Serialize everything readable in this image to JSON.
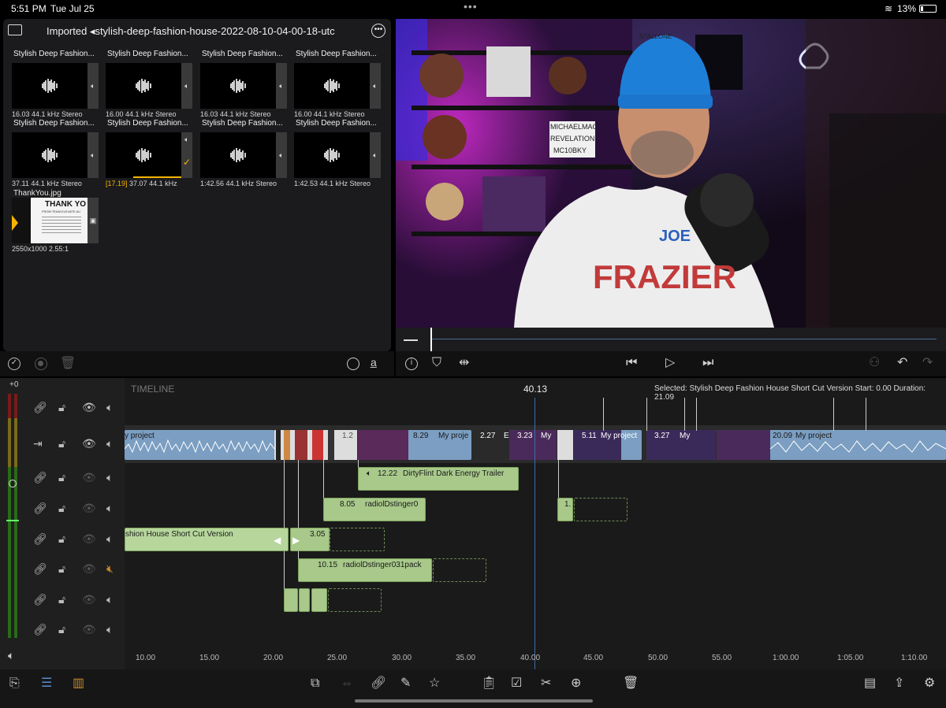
{
  "status_bar": {
    "time": "5:51 PM",
    "date": "Tue Jul 25",
    "battery": "13%",
    "dots": "•••"
  },
  "browser": {
    "folder_title": "Imported ◂stylish-deep-fashion-house-2022-08-10-04-00-18-utc",
    "items": [
      {
        "title": "Stylish Deep Fashion...",
        "meta": "16.03  44.1 kHz  Stereo"
      },
      {
        "title": "Stylish Deep Fashion...",
        "meta": "16.00  44.1 kHz  Stereo"
      },
      {
        "title": "Stylish Deep Fashion...",
        "meta": "16.03  44.1 kHz  Stereo"
      },
      {
        "title": "Stylish Deep Fashion...",
        "meta": "16.00  44.1 kHz  Stereo"
      },
      {
        "title": "Stylish Deep Fashion...",
        "meta": "37.11  44.1 kHz  Stereo"
      },
      {
        "title": "Stylish Deep Fashion...",
        "meta_highlight": "[17.19]",
        "meta": "37.07  44.1 kHz"
      },
      {
        "title": "Stylish Deep Fashion...",
        "meta": "1:42.56  44.1 kHz  Stereo"
      },
      {
        "title": "Stylish Deep Fashion...",
        "meta": "1:42.53  44.1 kHz  Stereo"
      }
    ],
    "image_item": {
      "title": "ThankYou.jpg",
      "meta": "2550x1000  2.55:1",
      "heading": "THANK YO",
      "sub": "FROM TEAM ELEVATE AU"
    }
  },
  "preview": {
    "scene_texts": [
      "STALLONE",
      "MICHAELMAC",
      "REVELATION",
      "MC10BKY",
      "JOE",
      "FRAZIER"
    ]
  },
  "timeline": {
    "label": "TIMELINE",
    "playhead_time": "40.13",
    "selected_info": "Selected: Stylish Deep Fashion House Short Cut Version Start: 0.00 Duration: 21.09",
    "level_zero": "+0",
    "clips": {
      "main_a": "y project",
      "main_b_dur": "8.29",
      "main_b": "My proje",
      "gap_dur": "2.27",
      "gap_label": "E",
      "main_c_dur": "3.23",
      "main_c": "My",
      "main_d_dur": "5.11",
      "main_d": "My project",
      "main_e_dur": "3.27",
      "main_e": "My",
      "main_f_dur": "20.09",
      "main_f": "My project",
      "small_dur": "1.2",
      "dirty_dur": "12.22",
      "dirty": "DirtyFlint  Dark Energy Trailer",
      "radio1_dur": "8.05",
      "radio1": "radiolDstinger0",
      "tiny_dur": "1.",
      "fashion": "shion House Short Cut Version",
      "fashion2_dur": "3.05",
      "radio2_dur": "10.15",
      "radio2": "radiolDstinger031pack"
    },
    "ruler": [
      "10.00",
      "15.00",
      "20.00",
      "25.00",
      "30.00",
      "35.00",
      "40.00",
      "45.00",
      "50.00",
      "55.00",
      "1:00.00",
      "1:05.00",
      "1:10.00"
    ]
  },
  "icons": {
    "folder": "folder-icon",
    "more": "more-icon",
    "check": "checkmark-icon"
  },
  "colors": {
    "accent": "#f5b400",
    "audio_clip": "#a8c98a",
    "video_clip": "#7b9ec2",
    "timeline_bg": "#1a1a1a"
  }
}
